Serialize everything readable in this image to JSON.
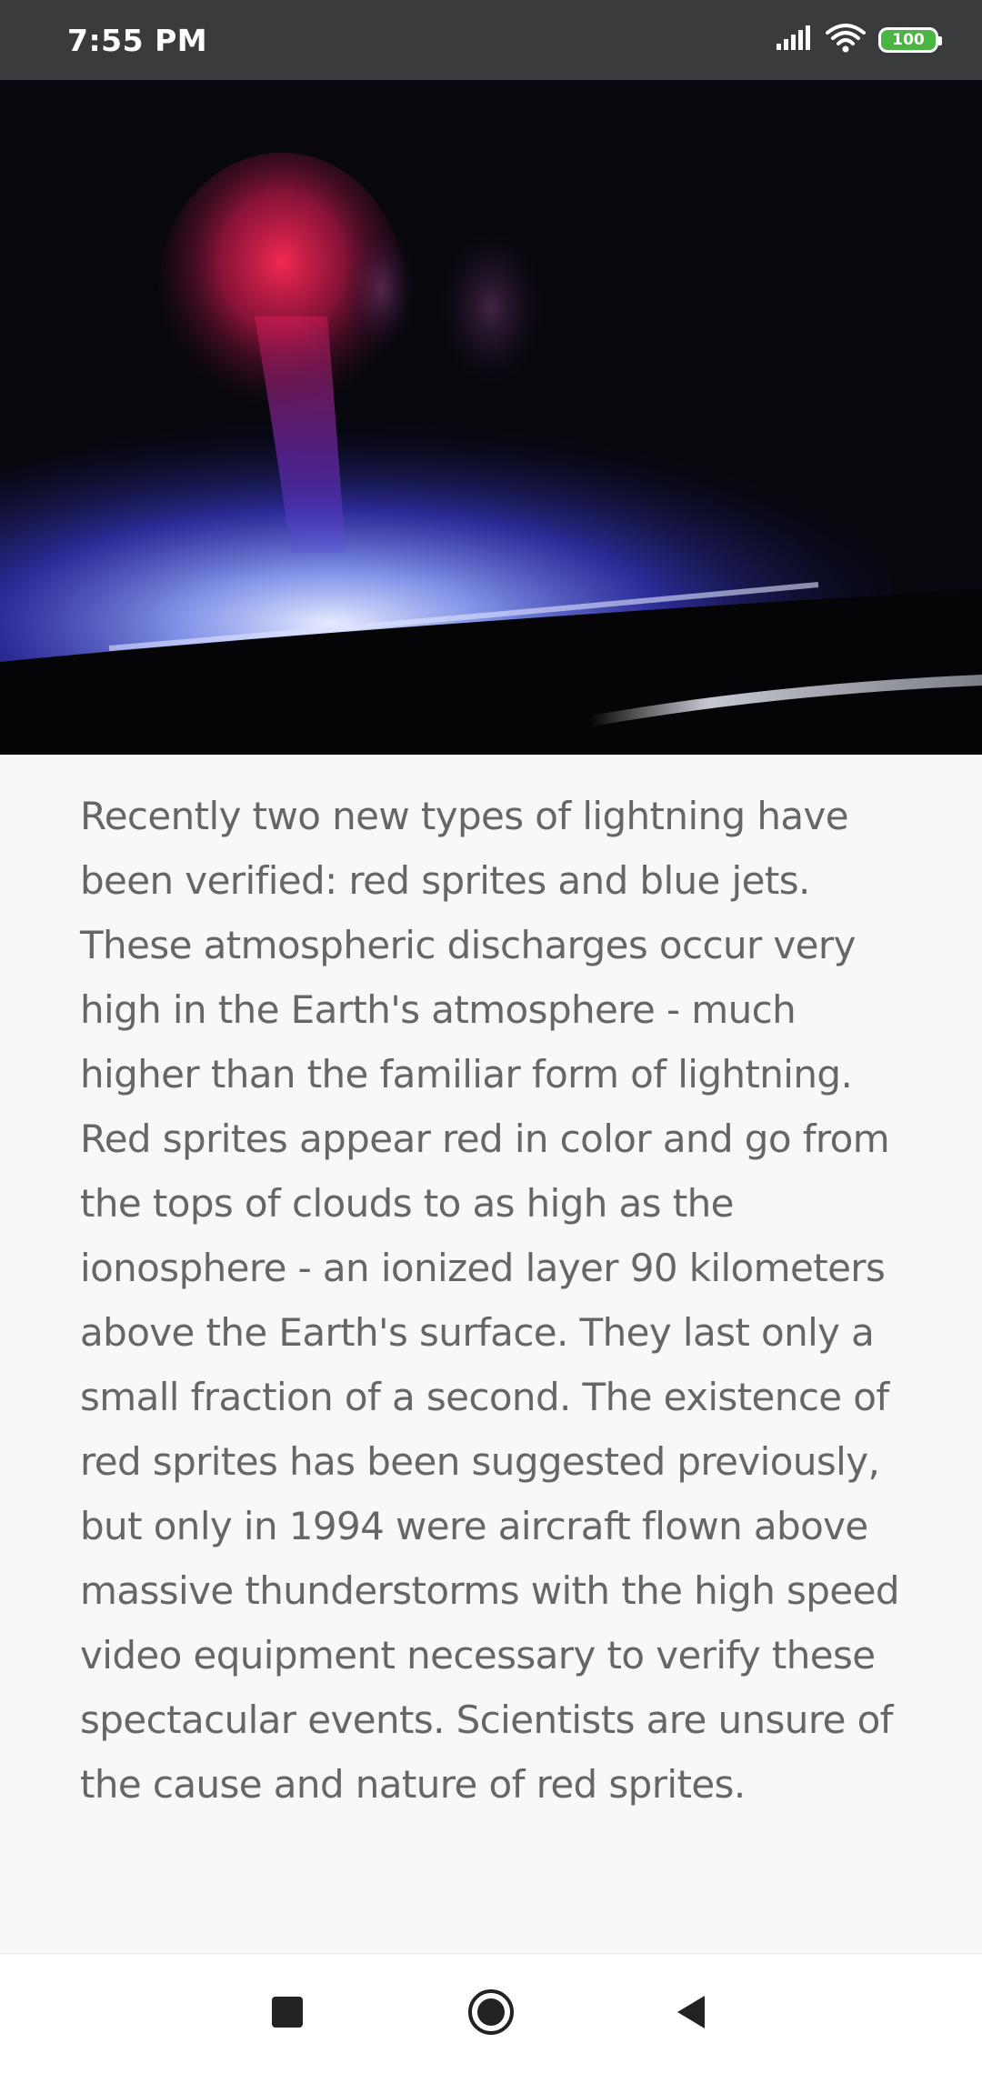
{
  "status_bar": {
    "time": "7:55 PM",
    "battery_level": "100",
    "icons": [
      "signal-icon",
      "wifi-icon",
      "battery-icon"
    ]
  },
  "hero_image": {
    "description_icon": "lightning-sprite-photo"
  },
  "article": {
    "body": "Recently two new types of lightning have been verified: red sprites and blue jets. These atmospheric discharges occur very high in the Earth's atmosphere - much higher than the familiar form of lightning. Red sprites appear red in color and go from the tops of clouds to as high as the ionosphere - an ionized layer 90 kilometers above the Earth's surface. They last only a small fraction of a second.  The existence of red sprites has been suggested previously, but only in 1994 were aircraft flown above massive thunderstorms with the high speed video equipment necessary to verify these spectacular events. Scientists are unsure of the cause and nature of red sprites."
  },
  "nav_bar": {
    "buttons": [
      "recents-icon",
      "home-icon",
      "back-icon"
    ]
  },
  "colors": {
    "status_bar_bg": "#3a3b3d",
    "page_bg": "#f8f8f8",
    "text": "#666666",
    "battery": "#4bb543"
  }
}
